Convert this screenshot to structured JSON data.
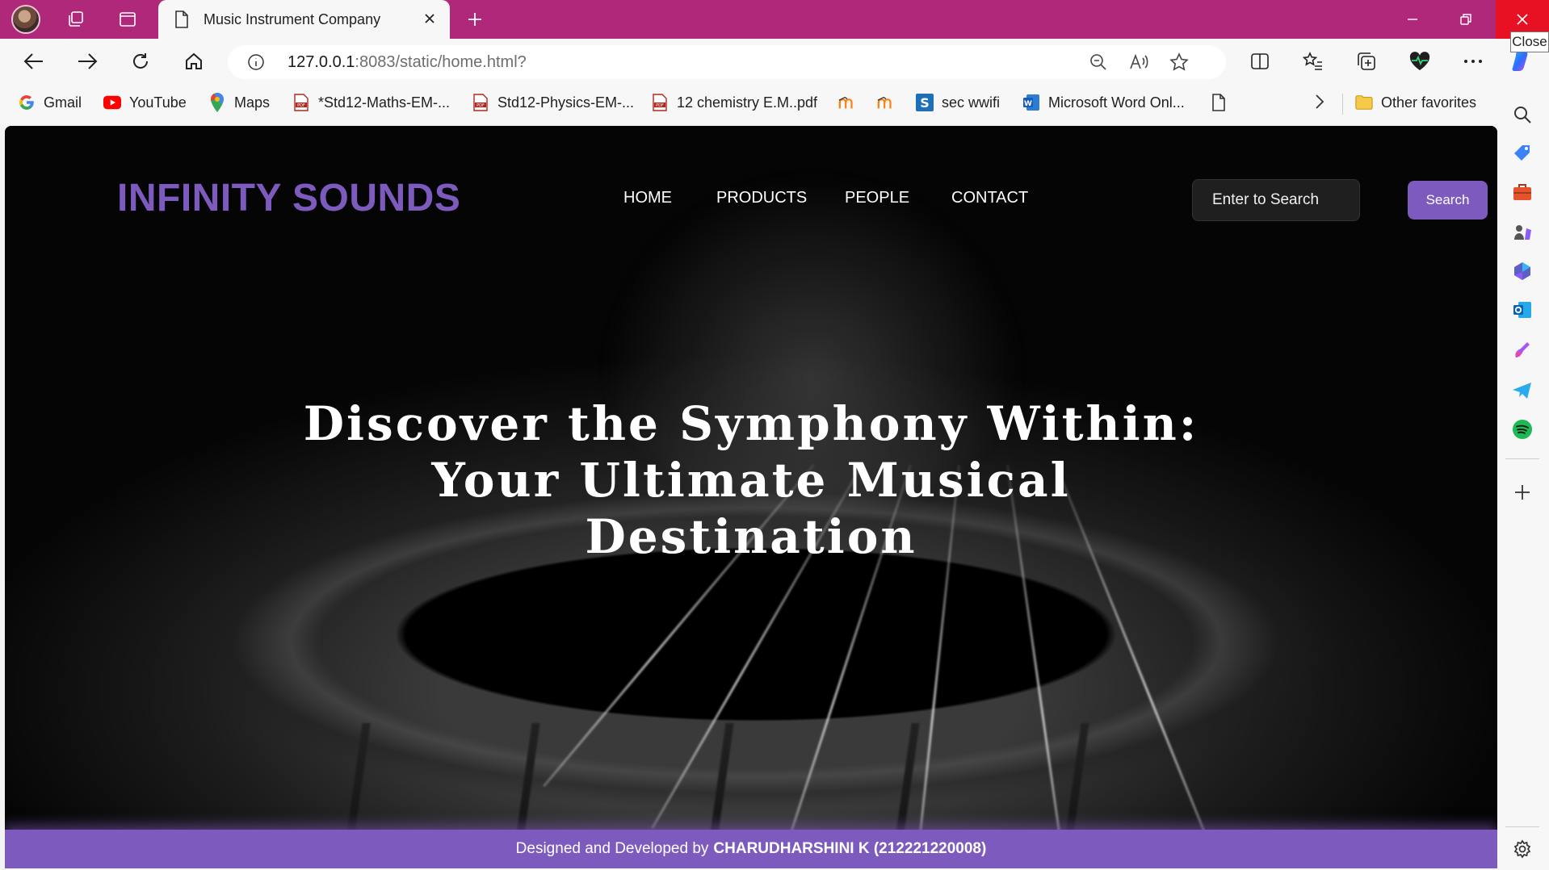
{
  "browser": {
    "tab_title": "Music Instrument Company",
    "close_tooltip": "Close",
    "url_host": "127.0.0.1",
    "url_rest": ":8083/static/home.html?",
    "favorites": [
      {
        "label": "Gmail",
        "icon": "gmail-icon"
      },
      {
        "label": "YouTube",
        "icon": "youtube-icon"
      },
      {
        "label": "Maps",
        "icon": "maps-icon"
      },
      {
        "label": "*Std12-Maths-EM-...",
        "icon": "pdf-icon"
      },
      {
        "label": "Std12-Physics-EM-...",
        "icon": "pdf-icon"
      },
      {
        "label": "12 chemistry E.M..pdf",
        "icon": "pdf-icon"
      },
      {
        "label": "sec wwifi",
        "icon": "s-app-icon"
      },
      {
        "label": "Microsoft Word Onl...",
        "icon": "word-icon"
      }
    ],
    "other_favorites": "Other favorites"
  },
  "site": {
    "logo_part1": "INFINITY",
    "logo_part2": "SOUNDS",
    "nav": [
      "HOME",
      "PRODUCTS",
      "PEOPLE",
      "CONTACT"
    ],
    "search_placeholder": "Enter to Search",
    "search_button": "Search",
    "headline_line1": "Discover the Symphony Within:",
    "headline_line2": "Your Ultimate Musical",
    "headline_line3": "Destination",
    "footer_prefix": "Designed and Developed by",
    "footer_name": "CHARUDHARSHINI K (212221220008)"
  },
  "colors": {
    "titlebar": "#b0287a",
    "accent_purple": "#7d5bbe",
    "close_red": "#e81123"
  }
}
